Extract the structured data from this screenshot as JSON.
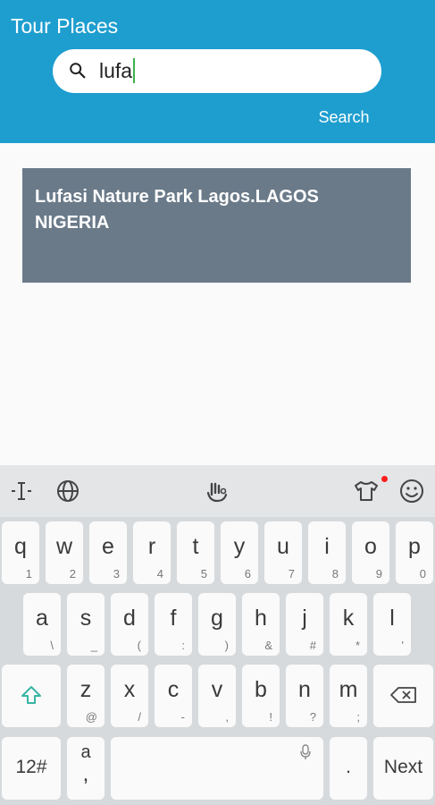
{
  "app": {
    "title": "Tour Places"
  },
  "search": {
    "value": "lufa",
    "button_label": "Search"
  },
  "results": [
    {
      "title": "Lufasi Nature Park Lagos.LAGOS NIGERIA"
    }
  ],
  "keyboard": {
    "toolbar_icons": [
      "text-cursor-icon",
      "globe-icon",
      "gesture-icon",
      "theme-shirt-icon",
      "emoji-icon"
    ],
    "row1": [
      {
        "k": "q",
        "s": "1"
      },
      {
        "k": "w",
        "s": "2"
      },
      {
        "k": "e",
        "s": "3"
      },
      {
        "k": "r",
        "s": "4"
      },
      {
        "k": "t",
        "s": "5"
      },
      {
        "k": "y",
        "s": "6"
      },
      {
        "k": "u",
        "s": "7"
      },
      {
        "k": "i",
        "s": "8"
      },
      {
        "k": "o",
        "s": "9"
      },
      {
        "k": "p",
        "s": "0"
      }
    ],
    "row2": [
      {
        "k": "a",
        "s": "\\"
      },
      {
        "k": "s",
        "s": "_"
      },
      {
        "k": "d",
        "s": "("
      },
      {
        "k": "f",
        "s": ":"
      },
      {
        "k": "g",
        "s": ")"
      },
      {
        "k": "h",
        "s": "&"
      },
      {
        "k": "j",
        "s": "#"
      },
      {
        "k": "k",
        "s": "*"
      },
      {
        "k": "l",
        "s": "'"
      }
    ],
    "row3": [
      {
        "k": "z",
        "s": "@"
      },
      {
        "k": "x",
        "s": "/"
      },
      {
        "k": "c",
        "s": "-"
      },
      {
        "k": "v",
        "s": ","
      },
      {
        "k": "b",
        "s": "!"
      },
      {
        "k": "n",
        "s": "?"
      },
      {
        "k": "m",
        "s": ";"
      }
    ],
    "symbols_label": "12#",
    "comma_key": {
      "top": "a",
      "bottom": ","
    },
    "period_key": ".",
    "next_label": "Next"
  },
  "colors": {
    "header": "#1e9ecf",
    "card": "#6a7a89",
    "caret": "#3db34a",
    "shift": "#39b5a5"
  }
}
